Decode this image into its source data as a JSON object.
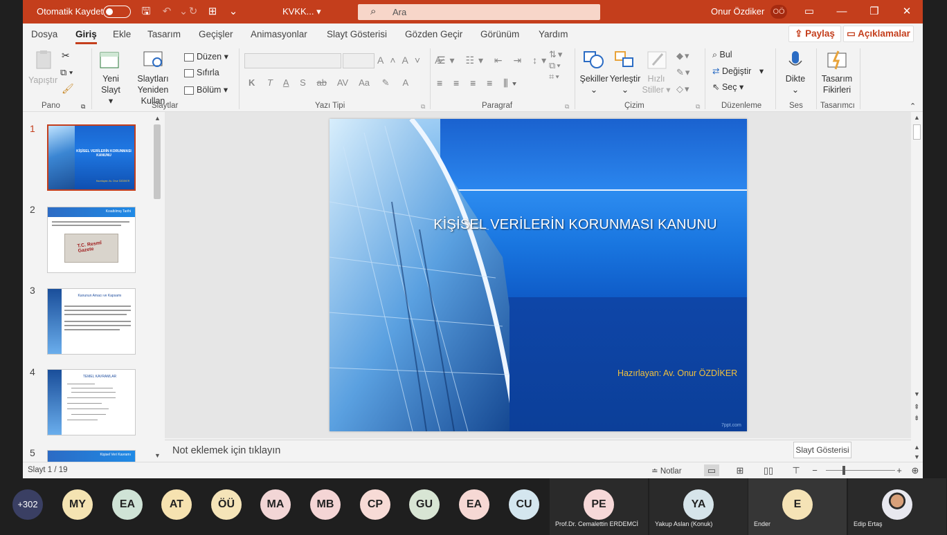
{
  "titlebar": {
    "autosave_label": "Otomatik Kaydet",
    "filename": "KVKK...",
    "search_placeholder": "Ara",
    "user_name": "Onur Özdiker",
    "user_initials": "OÖ"
  },
  "tabs": [
    "Dosya",
    "Giriş",
    "Ekle",
    "Tasarım",
    "Geçişler",
    "Animasyonlar",
    "Slayt Gösterisi",
    "Gözden Geçir",
    "Görünüm",
    "Yardım"
  ],
  "actions": {
    "share": "Paylaş",
    "comments": "Açıklamalar"
  },
  "ribbon": {
    "pano": {
      "paste": "Yapıştır",
      "label": "Pano"
    },
    "slaytlar": {
      "new_slide_line1": "Yeni",
      "new_slide_line2": "Slayt",
      "reuse_line1": "Slaytları",
      "reuse_line2": "Yeniden Kullan",
      "layout": "Düzen",
      "reset": "Sıfırla",
      "section": "Bölüm",
      "label": "Slaytlar"
    },
    "font": {
      "label": "Yazı Tipi",
      "bold": "K",
      "italic": "T",
      "underline": "A",
      "shadow": "S",
      "strike": "ab",
      "spacing": "AV",
      "case": "Aa"
    },
    "paragraph": {
      "label": "Paragraf"
    },
    "drawing": {
      "shapes": "Şekiller",
      "arrange": "Yerleştir",
      "quick_line1": "Hızlı",
      "quick_line2": "Stiller",
      "label": "Çizim"
    },
    "editing": {
      "find": "Bul",
      "replace": "Değiştir",
      "select": "Seç",
      "label": "Düzenleme"
    },
    "voice": {
      "dictate": "Dikte",
      "label": "Ses"
    },
    "designer": {
      "ideas_line1": "Tasarım",
      "ideas_line2": "Fikirleri",
      "label": "Tasarımcı"
    }
  },
  "thumbnails": [
    {
      "num": "1",
      "title": "KİŞİSEL VERİLERİN KORUNMASI KANUNU",
      "sub": "Hazırlayan: Av. Onur ÖZDİKER"
    },
    {
      "num": "2",
      "title": "Kısaltılmış Tarihi",
      "stamp": "T.C. Resmî Gazete"
    },
    {
      "num": "3",
      "title": "Kanunun Amacı ve Kapsamı"
    },
    {
      "num": "4",
      "title": "TEMEL KAVRAMLAR"
    },
    {
      "num": "5",
      "title": "Kişisel Veri Kavramı"
    }
  ],
  "slide": {
    "title": "KİŞİSEL VERİLERİN KORUNMASI KANUNU",
    "author": "Hazırlayan: Av. Onur ÖZDİKER",
    "watermark": "7ppt.com"
  },
  "notes_placeholder": "Not eklemek için tıklayın",
  "tooltip": "Slayt Gösterisi",
  "status": {
    "slide_count": "Slayt 1 / 19",
    "notes": "Notlar"
  },
  "participants": {
    "more": "+302",
    "avatars": [
      {
        "initials": "MY",
        "color": "#f4e3b2"
      },
      {
        "initials": "EA",
        "color": "#cfe3d6"
      },
      {
        "initials": "AT",
        "color": "#f6e2b0"
      },
      {
        "initials": "ÖÜ",
        "color": "#f5e4b8"
      },
      {
        "initials": "MA",
        "color": "#f2d6d6"
      },
      {
        "initials": "MB",
        "color": "#f4d5d5"
      },
      {
        "initials": "CP",
        "color": "#f7dbd6"
      },
      {
        "initials": "GU",
        "color": "#d8e5d4"
      },
      {
        "initials": "EA",
        "color": "#f6d8d4"
      },
      {
        "initials": "CU",
        "color": "#d4e6ef"
      }
    ],
    "tiles": [
      {
        "initials": "PE",
        "name": "Prof.Dr. Cemalettin ERDEMCİ",
        "color": "#f6d8d8"
      },
      {
        "initials": "YA",
        "name": "Yakup Aslan (Konuk)",
        "color": "#d6e4ea"
      },
      {
        "initials": "E",
        "name": "Ender",
        "color": "#f5e3b6"
      },
      {
        "initials": "",
        "name": "Edip Ertaş",
        "color": "#ffffff"
      }
    ]
  }
}
